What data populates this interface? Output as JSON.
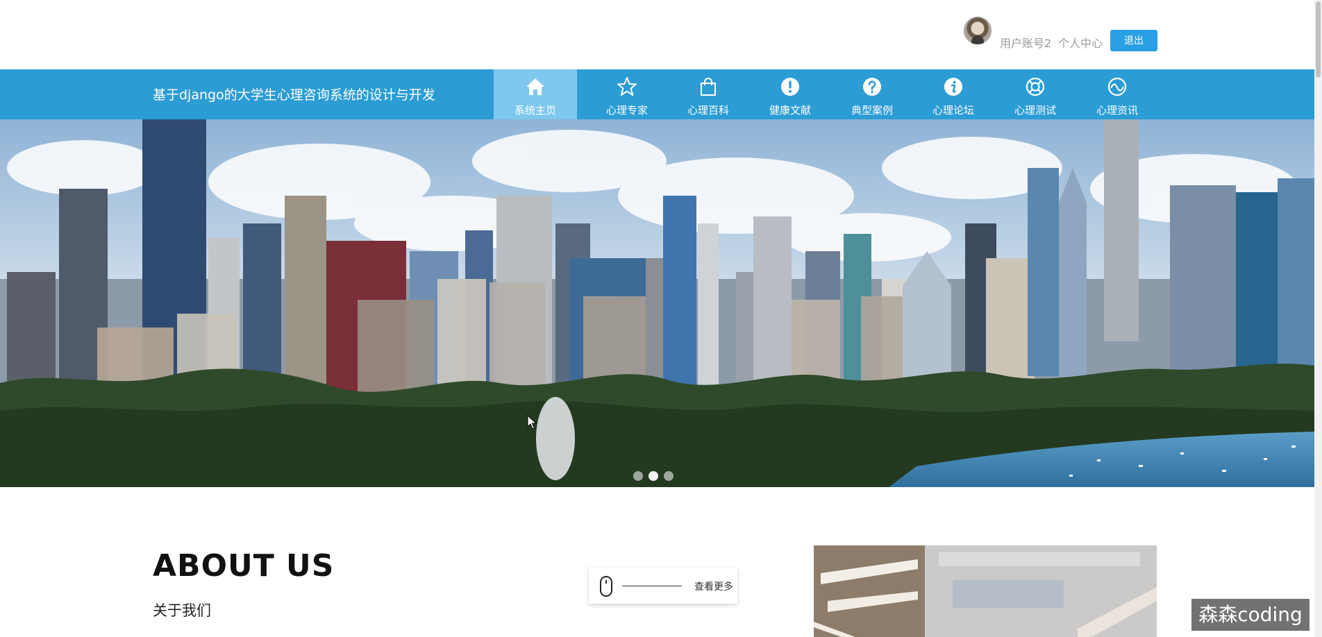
{
  "header": {
    "username": "用户账号2",
    "user_center": "个人中心",
    "logout": "退出"
  },
  "nav": {
    "site_title": "基于django的大学生心理咨询系统的设计与开发",
    "items": [
      {
        "label": "系统主页",
        "icon": "home-icon",
        "active": true
      },
      {
        "label": "心理专家",
        "icon": "star-icon"
      },
      {
        "label": "心理百科",
        "icon": "shopping-bag-icon"
      },
      {
        "label": "健康文献",
        "icon": "exclamation-icon"
      },
      {
        "label": "典型案例",
        "icon": "question-icon"
      },
      {
        "label": "心理论坛",
        "icon": "info-icon"
      },
      {
        "label": "心理测试",
        "icon": "lifebuoy-icon"
      },
      {
        "label": "心理资讯",
        "icon": "wave-circle-icon"
      }
    ]
  },
  "banner": {
    "scene": "city-skyline-photo",
    "slides_count": 3,
    "active_slide": 1
  },
  "about": {
    "title": "ABOUT US",
    "subtitle": "关于我们",
    "more_label": "查看更多"
  },
  "watermark": "森森coding",
  "colors": {
    "nav_bg": "#2b9cd4",
    "nav_active_bg": "#7ec8ed",
    "logout_bg": "#2a9fe3"
  }
}
